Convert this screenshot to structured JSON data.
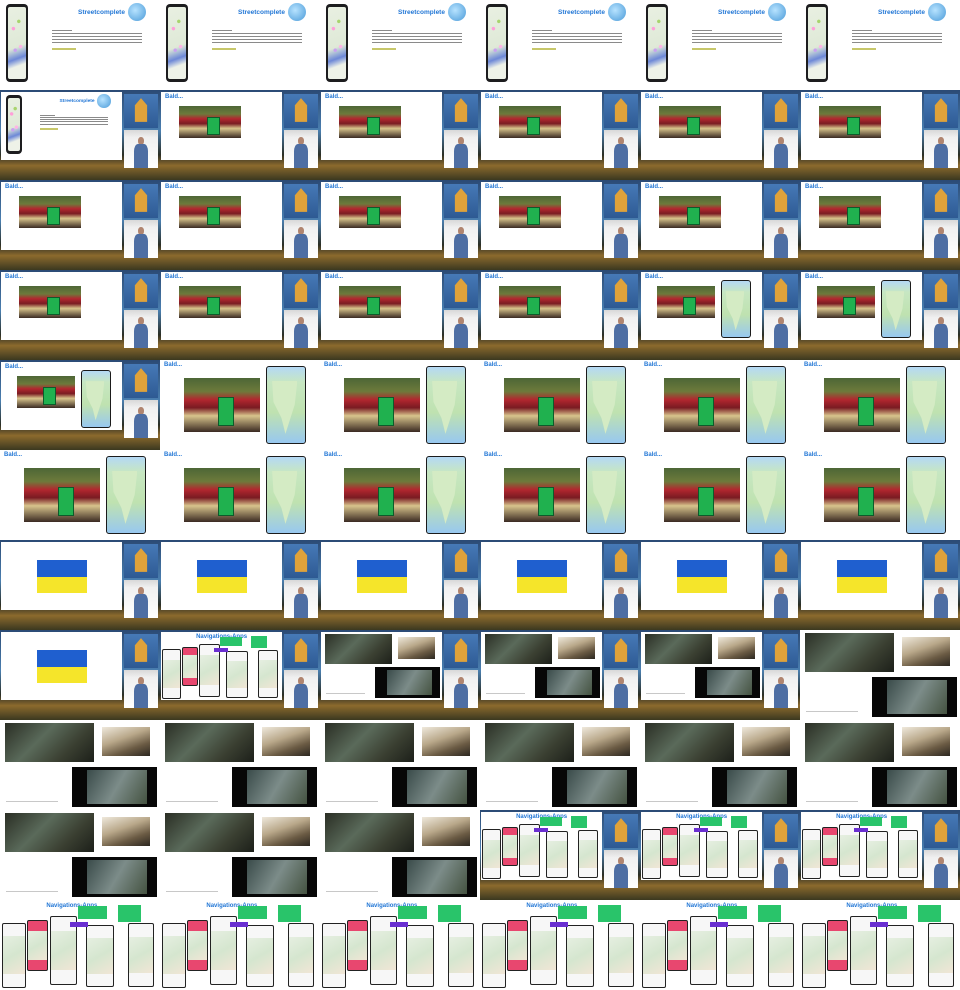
{
  "columns": 6,
  "rows": 11,
  "slides": {
    "streetcomplete": {
      "title": "Streetcomplete"
    },
    "bald": {
      "title": "Bald..."
    },
    "navigation": {
      "title": "Navigations-Apps"
    }
  },
  "frames": [
    {
      "kind": "streetcomplete-full"
    },
    {
      "kind": "streetcomplete-full"
    },
    {
      "kind": "streetcomplete-full"
    },
    {
      "kind": "streetcomplete-full"
    },
    {
      "kind": "streetcomplete-full"
    },
    {
      "kind": "streetcomplete-full"
    },
    {
      "kind": "streetcomplete-speaker"
    },
    {
      "kind": "traffic-speaker"
    },
    {
      "kind": "traffic-speaker"
    },
    {
      "kind": "traffic-speaker"
    },
    {
      "kind": "traffic-speaker"
    },
    {
      "kind": "traffic-speaker"
    },
    {
      "kind": "traffic-speaker"
    },
    {
      "kind": "traffic-speaker"
    },
    {
      "kind": "traffic-speaker"
    },
    {
      "kind": "traffic-speaker"
    },
    {
      "kind": "traffic-speaker"
    },
    {
      "kind": "traffic-speaker"
    },
    {
      "kind": "traffic-speaker"
    },
    {
      "kind": "traffic-speaker"
    },
    {
      "kind": "traffic-speaker"
    },
    {
      "kind": "traffic-speaker"
    },
    {
      "kind": "traffic-map-speaker"
    },
    {
      "kind": "traffic-map-speaker"
    },
    {
      "kind": "traffic-map-speaker"
    },
    {
      "kind": "traffic-map-full"
    },
    {
      "kind": "traffic-map-full"
    },
    {
      "kind": "traffic-map-full"
    },
    {
      "kind": "traffic-map-full"
    },
    {
      "kind": "traffic-map-full"
    },
    {
      "kind": "traffic-map-full"
    },
    {
      "kind": "traffic-map-full"
    },
    {
      "kind": "traffic-map-full"
    },
    {
      "kind": "traffic-map-full"
    },
    {
      "kind": "traffic-map-full"
    },
    {
      "kind": "traffic-map-full"
    },
    {
      "kind": "flag-speaker"
    },
    {
      "kind": "flag-speaker"
    },
    {
      "kind": "flag-speaker"
    },
    {
      "kind": "flag-speaker"
    },
    {
      "kind": "flag-speaker"
    },
    {
      "kind": "flag-speaker"
    },
    {
      "kind": "flag-speaker"
    },
    {
      "kind": "nav-speaker"
    },
    {
      "kind": "military-speaker"
    },
    {
      "kind": "military-speaker"
    },
    {
      "kind": "military-speaker"
    },
    {
      "kind": "military-full"
    },
    {
      "kind": "military-full"
    },
    {
      "kind": "military-full"
    },
    {
      "kind": "military-full"
    },
    {
      "kind": "military-full"
    },
    {
      "kind": "military-full"
    },
    {
      "kind": "military-full"
    },
    {
      "kind": "military-full"
    },
    {
      "kind": "military-full"
    },
    {
      "kind": "military-full"
    },
    {
      "kind": "nav-speaker"
    },
    {
      "kind": "nav-speaker"
    },
    {
      "kind": "nav-speaker"
    },
    {
      "kind": "nav-full"
    },
    {
      "kind": "nav-full"
    },
    {
      "kind": "nav-full"
    },
    {
      "kind": "nav-full"
    },
    {
      "kind": "nav-full"
    },
    {
      "kind": "nav-full"
    }
  ]
}
